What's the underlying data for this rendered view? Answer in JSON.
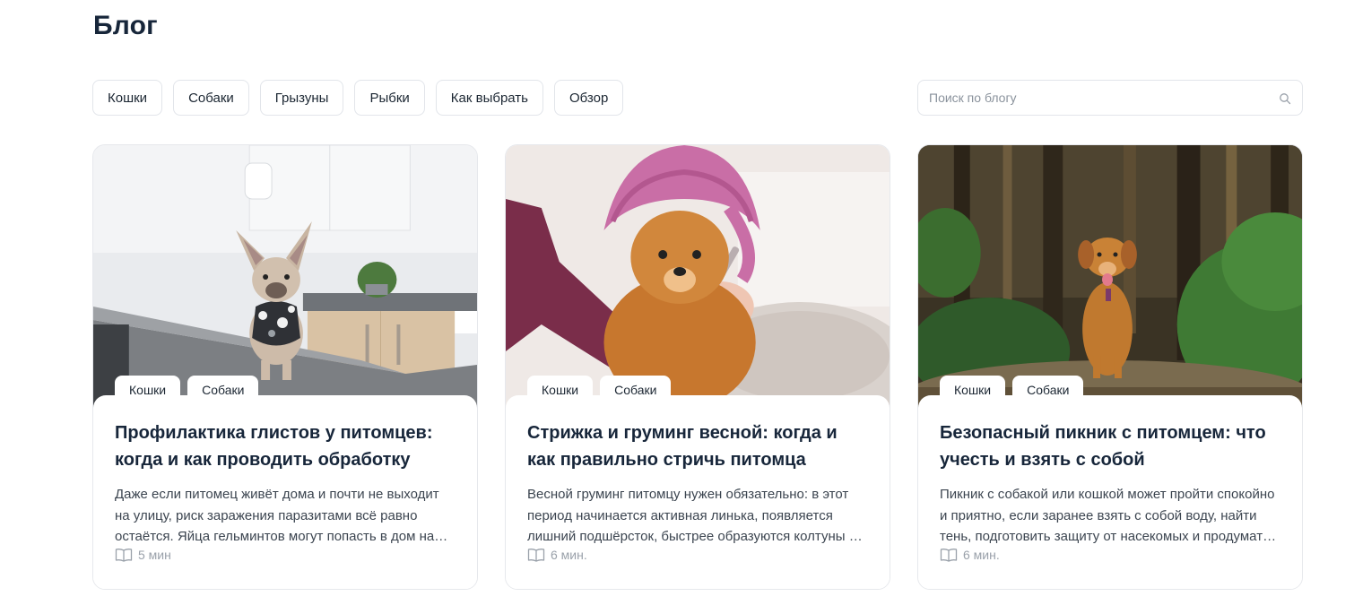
{
  "page": {
    "title": "Блог"
  },
  "filters": [
    "Кошки",
    "Собаки",
    "Грызуны",
    "Рыбки",
    "Как выбрать",
    "Обзор"
  ],
  "search": {
    "placeholder": "Поиск по блогу",
    "value": ""
  },
  "cards": [
    {
      "tags": [
        "Кошки",
        "Собаки"
      ],
      "title": "Профилактика глистов у питомцев: когда и как проводить обработку",
      "description": "Даже если питомец живёт дома и почти не выходит на улицу, риск заражения паразитами всё равно остаётся. Яйца гельминтов могут попасть в дом на обуви, одежде или с уличной пылью.",
      "read_time": "5 мин",
      "image": "french-bulldog-on-kitchen-table"
    },
    {
      "tags": [
        "Кошки",
        "Собаки"
      ],
      "title": "Стрижка и груминг весной: когда и как правильно стричь питомца",
      "description": "Весной груминг питомцу нужен обязательно: в этот период начинается активная линька, появляется лишний подшёрсток, быстрее образуются колтуны и запутывается шерсть.",
      "read_time": "6 мин.",
      "image": "pomeranian-in-pink-towel"
    },
    {
      "tags": [
        "Кошки",
        "Собаки"
      ],
      "title": "Безопасный пикник с питомцем: что учесть и взять с собой",
      "description": "Пикник с собакой или кошкой может пройти спокойно и приятно, если заранее взять с собой воду, найти тень, подготовить защиту от насекомых и продумать безопасность.",
      "read_time": "6 мин.",
      "image": "dog-in-forest"
    }
  ],
  "colors": {
    "text_dark": "#17263a",
    "border": "#e2e5ea",
    "muted": "#9aa1aa"
  },
  "icons": {
    "search": "search-icon",
    "read_time": "book-icon"
  }
}
